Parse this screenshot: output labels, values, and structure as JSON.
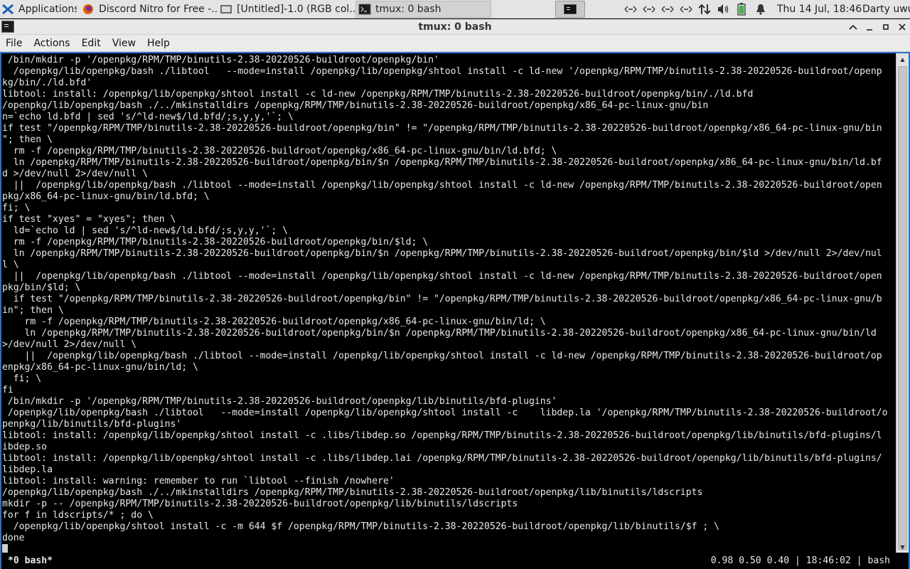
{
  "panel": {
    "apps_label": "Applications",
    "tasks": [
      {
        "label": "Discord Nitro for Free -..."
      },
      {
        "label": "[Untitled]-1.0 (RGB col..."
      },
      {
        "label": "tmux: 0 bash"
      }
    ],
    "clock": "Thu 14 Jul, 18:46",
    "user": "Darty uwu"
  },
  "window": {
    "title": "tmux: 0 bash"
  },
  "menubar": {
    "items": [
      "File",
      "Actions",
      "Edit",
      "View",
      "Help"
    ]
  },
  "terminal": {
    "lines": [
      " /bin/mkdir -p '/openpkg/RPM/TMP/binutils-2.38-20220526-buildroot/openpkg/bin'",
      "  /openpkg/lib/openpkg/bash ./libtool   --mode=install /openpkg/lib/openpkg/shtool install -c ld-new '/openpkg/RPM/TMP/binutils-2.38-20220526-buildroot/openp",
      "kg/bin/./ld.bfd'",
      "libtool: install: /openpkg/lib/openpkg/shtool install -c ld-new /openpkg/RPM/TMP/binutils-2.38-20220526-buildroot/openpkg/bin/./ld.bfd",
      "/openpkg/lib/openpkg/bash ./../mkinstalldirs /openpkg/RPM/TMP/binutils-2.38-20220526-buildroot/openpkg/x86_64-pc-linux-gnu/bin",
      "n=`echo ld.bfd | sed 's/^ld-new$/ld.bfd/;s,y,y,'`; \\",
      "if test \"/openpkg/RPM/TMP/binutils-2.38-20220526-buildroot/openpkg/bin\" != \"/openpkg/RPM/TMP/binutils-2.38-20220526-buildroot/openpkg/x86_64-pc-linux-gnu/bin",
      "\"; then \\",
      "  rm -f /openpkg/RPM/TMP/binutils-2.38-20220526-buildroot/openpkg/x86_64-pc-linux-gnu/bin/ld.bfd; \\",
      "  ln /openpkg/RPM/TMP/binutils-2.38-20220526-buildroot/openpkg/bin/$n /openpkg/RPM/TMP/binutils-2.38-20220526-buildroot/openpkg/x86_64-pc-linux-gnu/bin/ld.bf",
      "d >/dev/null 2>/dev/null \\",
      "  ||  /openpkg/lib/openpkg/bash ./libtool --mode=install /openpkg/lib/openpkg/shtool install -c ld-new /openpkg/RPM/TMP/binutils-2.38-20220526-buildroot/open",
      "pkg/x86_64-pc-linux-gnu/bin/ld.bfd; \\",
      "fi; \\",
      "if test \"xyes\" = \"xyes\"; then \\",
      "  ld=`echo ld | sed 's/^ld-new$/ld.bfd/;s,y,y,'`; \\",
      "  rm -f /openpkg/RPM/TMP/binutils-2.38-20220526-buildroot/openpkg/bin/$ld; \\",
      "  ln /openpkg/RPM/TMP/binutils-2.38-20220526-buildroot/openpkg/bin/$n /openpkg/RPM/TMP/binutils-2.38-20220526-buildroot/openpkg/bin/$ld >/dev/null 2>/dev/nul",
      "l \\",
      "  ||  /openpkg/lib/openpkg/bash ./libtool --mode=install /openpkg/lib/openpkg/shtool install -c ld-new /openpkg/RPM/TMP/binutils-2.38-20220526-buildroot/open",
      "pkg/bin/$ld; \\",
      "  if test \"/openpkg/RPM/TMP/binutils-2.38-20220526-buildroot/openpkg/bin\" != \"/openpkg/RPM/TMP/binutils-2.38-20220526-buildroot/openpkg/x86_64-pc-linux-gnu/b",
      "in\"; then \\",
      "    rm -f /openpkg/RPM/TMP/binutils-2.38-20220526-buildroot/openpkg/x86_64-pc-linux-gnu/bin/ld; \\",
      "    ln /openpkg/RPM/TMP/binutils-2.38-20220526-buildroot/openpkg/bin/$n /openpkg/RPM/TMP/binutils-2.38-20220526-buildroot/openpkg/x86_64-pc-linux-gnu/bin/ld",
      ">/dev/null 2>/dev/null \\",
      "    ||  /openpkg/lib/openpkg/bash ./libtool --mode=install /openpkg/lib/openpkg/shtool install -c ld-new /openpkg/RPM/TMP/binutils-2.38-20220526-buildroot/op",
      "enpkg/x86_64-pc-linux-gnu/bin/ld; \\",
      "  fi; \\",
      "fi",
      " /bin/mkdir -p '/openpkg/RPM/TMP/binutils-2.38-20220526-buildroot/openpkg/lib/binutils/bfd-plugins'",
      " /openpkg/lib/openpkg/bash ./libtool   --mode=install /openpkg/lib/openpkg/shtool install -c    libdep.la '/openpkg/RPM/TMP/binutils-2.38-20220526-buildroot/o",
      "penpkg/lib/binutils/bfd-plugins'",
      "libtool: install: /openpkg/lib/openpkg/shtool install -c .libs/libdep.so /openpkg/RPM/TMP/binutils-2.38-20220526-buildroot/openpkg/lib/binutils/bfd-plugins/l",
      "ibdep.so",
      "libtool: install: /openpkg/lib/openpkg/shtool install -c .libs/libdep.lai /openpkg/RPM/TMP/binutils-2.38-20220526-buildroot/openpkg/lib/binutils/bfd-plugins/",
      "libdep.la",
      "libtool: install: warning: remember to run `libtool --finish /nowhere'",
      "/openpkg/lib/openpkg/bash ./../mkinstalldirs /openpkg/RPM/TMP/binutils-2.38-20220526-buildroot/openpkg/lib/binutils/ldscripts",
      "mkdir -p -- /openpkg/RPM/TMP/binutils-2.38-20220526-buildroot/openpkg/lib/binutils/ldscripts",
      "for f in ldscripts/* ; do \\",
      "  /openpkg/lib/openpkg/shtool install -c -m 644 $f /openpkg/RPM/TMP/binutils-2.38-20220526-buildroot/openpkg/lib/binutils/$f ; \\",
      "done"
    ]
  },
  "tmux": {
    "window_label": "*0 bash*",
    "status_right": "0.98 0.50 0.40 | 18:46:02 | bash"
  }
}
